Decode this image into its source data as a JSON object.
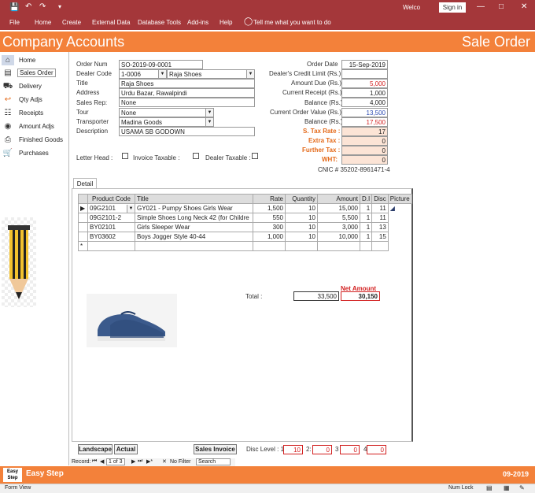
{
  "titlebar": {
    "welcome": "Welco",
    "sign_in": "Sign in"
  },
  "ribbon": {
    "tabs": [
      "File",
      "Home",
      "Create",
      "External Data",
      "Database Tools",
      "Add-ins",
      "Help"
    ],
    "tell_me": "Tell me what you want to do"
  },
  "header": {
    "app_title": "Company Accounts",
    "form_title": "Sale Order"
  },
  "sidebar": {
    "items": [
      {
        "label": "Home",
        "icon": "home-icon"
      },
      {
        "label": "Sales Order",
        "icon": "cash-register-icon"
      },
      {
        "label": "Delivery",
        "icon": "truck-icon"
      },
      {
        "label": "Qty Adjs",
        "icon": "undo-arrow-icon"
      },
      {
        "label": "Receipts",
        "icon": "receipt-icon"
      },
      {
        "label": "Amount Adjs",
        "icon": "coins-icon"
      },
      {
        "label": "Finished Goods",
        "icon": "printer-icon"
      },
      {
        "label": "Purchases",
        "icon": "cart-icon"
      }
    ]
  },
  "form": {
    "order_num_label": "Order Num",
    "order_num": "SO-2019-09-0001",
    "dealer_code_label": "Dealer Code",
    "dealer_code": "1-0006",
    "dealer_name": "Raja Shoes",
    "title_label": "Title",
    "title": "Raja Shoes",
    "address_label": "Address",
    "address": "Urdu Bazar, Rawalpindi",
    "sales_rep_label": "Sales Rep:",
    "sales_rep": "None",
    "tour_label": "Tour",
    "tour": "None",
    "transporter_label": "Transporter",
    "transporter": "Madina Goods",
    "description_label": "Description",
    "description": "USAMA SB GODOWN",
    "order_date_label": "Order Date",
    "order_date": "15-Sep-2019",
    "credit_limit_label": "Dealer's Credit Limit (Rs.)",
    "credit_limit": "",
    "amount_due_label": "Amount Due (Rs.)",
    "amount_due": "5,000",
    "current_receipt_label": "Current Receipt (Rs.)",
    "current_receipt": "1,000",
    "balance1_label": "Balance (Rs.)",
    "balance1": "4,000",
    "current_order_label": "Current Order Value (Rs.)",
    "current_order": "13,500",
    "balance2_label": "Balance (Rs.)",
    "balance2": "17,500",
    "s_tax_label": "S. Tax Rate :",
    "s_tax": "17",
    "extra_tax_label": "Extra Tax :",
    "extra_tax": "0",
    "further_tax_label": "Further Tax :",
    "further_tax": "0",
    "wht_label": "WHT:",
    "wht": "0",
    "cnic": "CNIC # 35202-8961471-4",
    "letter_head_label": "Letter Head :",
    "invoice_taxable_label": "Invoice Taxable :",
    "dealer_taxable_label": "Dealer Taxable :"
  },
  "detail": {
    "tab_label": "Detail",
    "headers": [
      "Product Code",
      "Title",
      "Rate",
      "Quantity",
      "Amount",
      "D.I",
      "Disc",
      "Picture"
    ],
    "rows": [
      [
        "09G2101",
        "GY021 - Pumpy Shoes Girls Wear",
        "1,500",
        "10",
        "15,000",
        "1",
        "11"
      ],
      [
        "09G2101-2",
        "Simple Shoes Long Neck 42 (for Childre",
        "550",
        "10",
        "5,500",
        "1",
        "11"
      ],
      [
        "BY02101",
        "Girls Sleeper Wear",
        "300",
        "10",
        "3,000",
        "1",
        "13"
      ],
      [
        "BY03602",
        "Boys Jogger Style 40-44",
        "1,000",
        "10",
        "10,000",
        "1",
        "15"
      ]
    ],
    "total_label": "Total :",
    "total": "33,500",
    "net_amount_label": "Net Amount",
    "net_amount": "30,150"
  },
  "buttons": {
    "landscape": "Landscape",
    "actual": "Actual",
    "sales_invoice": "Sales Invoice"
  },
  "disc": {
    "label": "Disc Level : 1:",
    "l1": "10",
    "l2_label": "2:",
    "l2": "0",
    "l3_label": "3",
    "l3": "0",
    "l4_label": "4",
    "l4": "0"
  },
  "nav": {
    "record_label": "Record:",
    "position": "1 of 3",
    "no_filter": "No Filter",
    "search": "Search"
  },
  "footer": {
    "logo": "Easy Step",
    "title": "Easy Step",
    "period": "09-2019"
  },
  "status": {
    "view": "Form View",
    "num_lock": "Num Lock"
  }
}
